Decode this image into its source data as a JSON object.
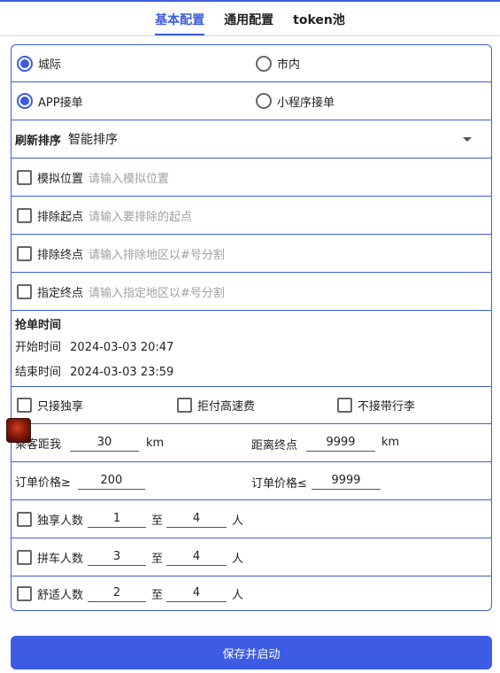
{
  "tabs": [
    {
      "label": "基本配置",
      "active": true
    },
    {
      "label": "通用配置",
      "active": false
    },
    {
      "label": "token池",
      "active": false
    }
  ],
  "trip_type": {
    "options": [
      "城际",
      "市内"
    ],
    "selected": "城际"
  },
  "order_source": {
    "options": [
      "APP接单",
      "小程序接单"
    ],
    "selected": "APP接单"
  },
  "sort": {
    "label": "刷新排序",
    "value": "智能排序"
  },
  "mock_location": {
    "label": "模拟位置",
    "placeholder": "请输入模拟位置",
    "checked": false
  },
  "exclude_start": {
    "label": "排除起点",
    "placeholder": "请输入要排除的起点",
    "checked": false
  },
  "exclude_end": {
    "label": "排除终点",
    "placeholder": "请输入排除地区以#号分割",
    "checked": false
  },
  "designated_end": {
    "label": "指定终点",
    "placeholder": "请输入指定地区以#号分割",
    "checked": false
  },
  "grab_time": {
    "title": "抢单时间",
    "start_label": "开始时间",
    "start_value": "2024-03-03 20:47",
    "end_label": "结束时间",
    "end_value": "2024-03-03 23:59"
  },
  "filters": {
    "exclusive_only": "只接独享",
    "reject_highway": "拒付高速费",
    "no_luggage": "不接带行李"
  },
  "distance": {
    "passenger_label": "乘客距我",
    "passenger_value": "30",
    "passenger_unit": "km",
    "dest_label": "距离终点",
    "dest_value": "9999",
    "dest_unit": "km"
  },
  "price": {
    "min_label": "订单价格≥",
    "min_value": "200",
    "max_label": "订单价格≤",
    "max_value": "9999"
  },
  "counts": [
    {
      "label": "独享人数",
      "from": "1",
      "to_label": "至",
      "to": "4",
      "unit": "人"
    },
    {
      "label": "拼车人数",
      "from": "3",
      "to_label": "至",
      "to": "4",
      "unit": "人"
    },
    {
      "label": "舒适人数",
      "from": "2",
      "to_label": "至",
      "to": "4",
      "unit": "人"
    }
  ],
  "save_button": "保存并启动",
  "colors": {
    "accent": "#3d5ce3"
  }
}
